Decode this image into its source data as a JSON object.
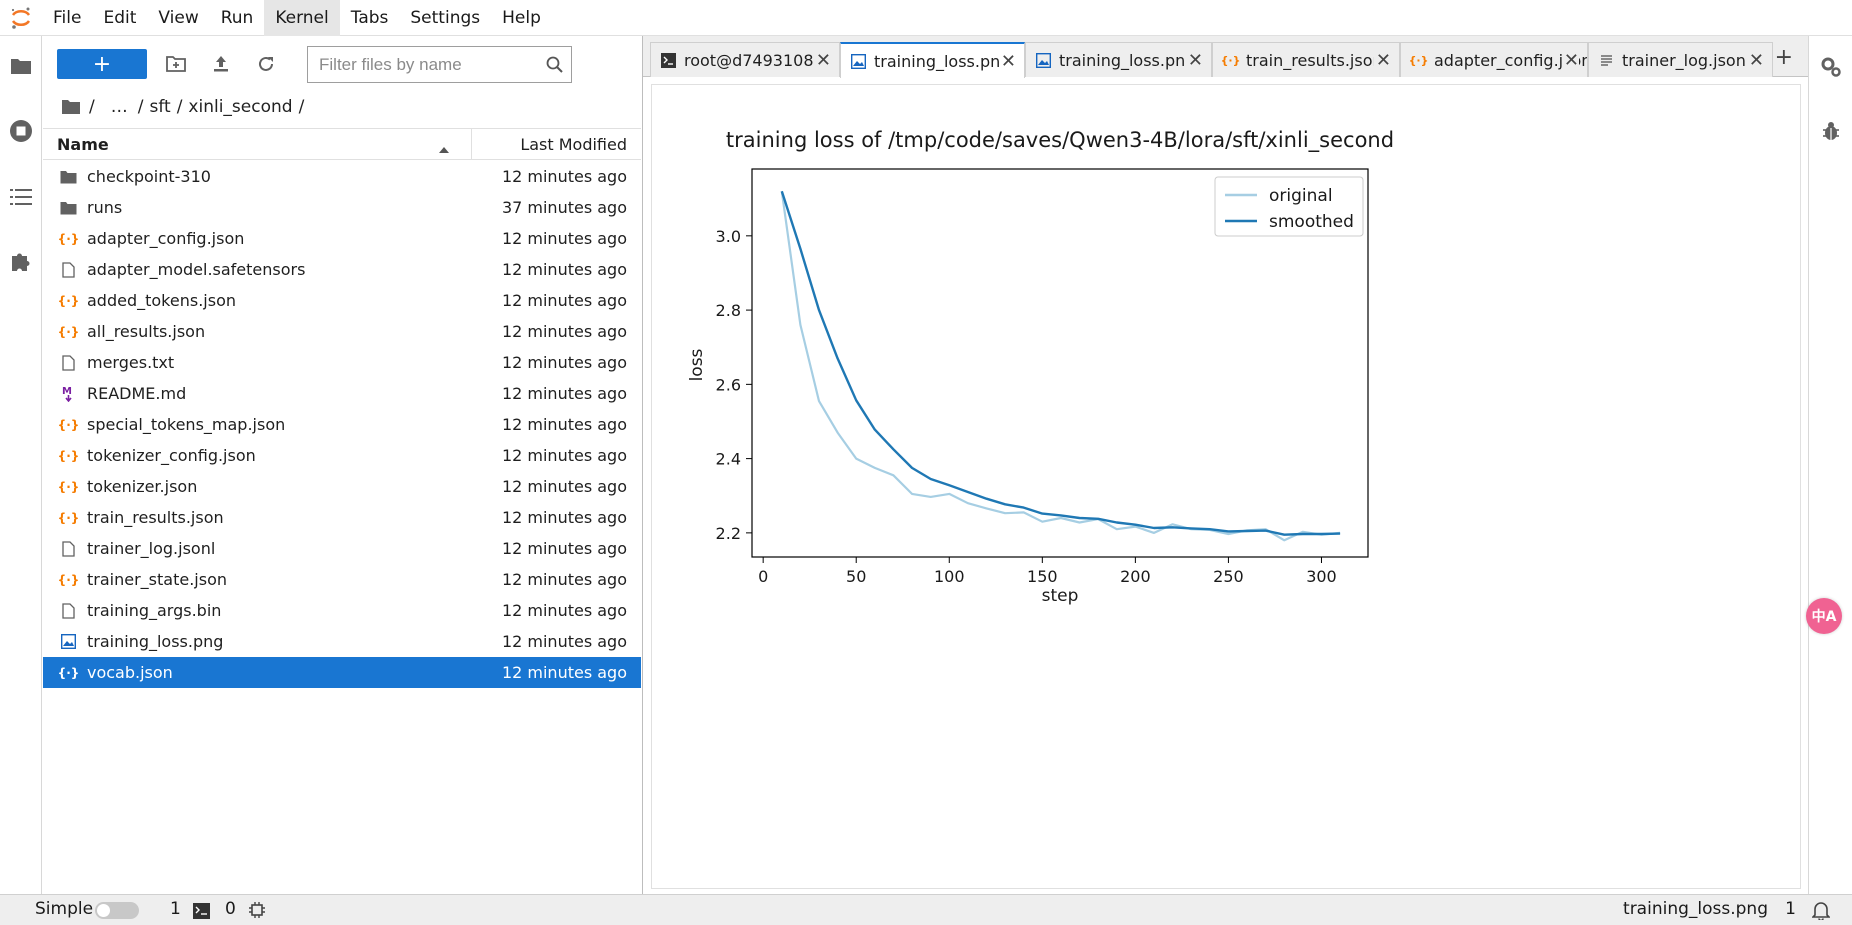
{
  "menu": {
    "items": [
      {
        "label": "File"
      },
      {
        "label": "Edit"
      },
      {
        "label": "View"
      },
      {
        "label": "Run"
      },
      {
        "label": "Kernel"
      },
      {
        "label": "Tabs"
      },
      {
        "label": "Settings"
      },
      {
        "label": "Help"
      }
    ],
    "active": "Kernel"
  },
  "filebrowser": {
    "new_button_label": "+",
    "filter_placeholder": "Filter files by name",
    "breadcrumb": [
      "/",
      "…",
      "/",
      "sft",
      "/",
      "xinli_second",
      "/"
    ],
    "columns": {
      "name": "Name",
      "modified": "Last Modified"
    },
    "files": [
      {
        "name": "checkpoint-310",
        "type": "folder",
        "modified": "12 minutes ago"
      },
      {
        "name": "runs",
        "type": "folder",
        "modified": "37 minutes ago"
      },
      {
        "name": "adapter_config.json",
        "type": "json",
        "modified": "12 minutes ago"
      },
      {
        "name": "adapter_model.safetensors",
        "type": "file",
        "modified": "12 minutes ago"
      },
      {
        "name": "added_tokens.json",
        "type": "json",
        "modified": "12 minutes ago"
      },
      {
        "name": "all_results.json",
        "type": "json",
        "modified": "12 minutes ago"
      },
      {
        "name": "merges.txt",
        "type": "file",
        "modified": "12 minutes ago"
      },
      {
        "name": "README.md",
        "type": "markdown",
        "modified": "12 minutes ago"
      },
      {
        "name": "special_tokens_map.json",
        "type": "json",
        "modified": "12 minutes ago"
      },
      {
        "name": "tokenizer_config.json",
        "type": "json",
        "modified": "12 minutes ago"
      },
      {
        "name": "tokenizer.json",
        "type": "json",
        "modified": "12 minutes ago"
      },
      {
        "name": "train_results.json",
        "type": "json",
        "modified": "12 minutes ago"
      },
      {
        "name": "trainer_log.jsonl",
        "type": "file",
        "modified": "12 minutes ago"
      },
      {
        "name": "trainer_state.json",
        "type": "json",
        "modified": "12 minutes ago"
      },
      {
        "name": "training_args.bin",
        "type": "file",
        "modified": "12 minutes ago"
      },
      {
        "name": "training_loss.png",
        "type": "image",
        "modified": "12 minutes ago"
      },
      {
        "name": "vocab.json",
        "type": "json",
        "modified": "12 minutes ago",
        "selected": true
      }
    ]
  },
  "tabs": [
    {
      "label": "root@d7493108",
      "icon": "terminal-icon"
    },
    {
      "label": "training_loss.png",
      "icon": "image-icon",
      "current": true
    },
    {
      "label": "training_loss.png",
      "icon": "image-icon"
    },
    {
      "label": "train_results.json",
      "icon": "json-icon"
    },
    {
      "label": "adapter_config.json",
      "icon": "json-icon"
    },
    {
      "label": "trainer_log.jsonl",
      "icon": "text-file-icon"
    }
  ],
  "chart_data": {
    "type": "line",
    "title": "training loss of /tmp/code/saves/Qwen3-4B/lora/sft/xinli_second",
    "xlabel": "step",
    "ylabel": "loss",
    "xlim": [
      -6,
      325
    ],
    "ylim": [
      2.135,
      3.18
    ],
    "xticks": [
      0,
      50,
      100,
      150,
      200,
      250,
      300
    ],
    "yticks": [
      2.2,
      2.4,
      2.6,
      2.8,
      3.0
    ],
    "legend_position": "top-right",
    "x": [
      10,
      20,
      30,
      40,
      50,
      60,
      70,
      80,
      90,
      100,
      110,
      120,
      130,
      140,
      150,
      160,
      170,
      180,
      190,
      200,
      210,
      220,
      230,
      240,
      250,
      260,
      270,
      280,
      290,
      300,
      310
    ],
    "series": [
      {
        "name": "original",
        "color": "#a6cee3",
        "values": [
          3.12,
          2.76,
          2.555,
          2.47,
          2.4,
          2.375,
          2.355,
          2.305,
          2.297,
          2.305,
          2.28,
          2.266,
          2.253,
          2.255,
          2.23,
          2.24,
          2.228,
          2.237,
          2.21,
          2.217,
          2.2,
          2.223,
          2.21,
          2.208,
          2.197,
          2.207,
          2.21,
          2.18,
          2.203,
          2.195,
          2.2
        ]
      },
      {
        "name": "smoothed",
        "color": "#1f78b4",
        "values": [
          3.12,
          2.965,
          2.8,
          2.67,
          2.557,
          2.478,
          2.425,
          2.375,
          2.345,
          2.328,
          2.31,
          2.292,
          2.277,
          2.268,
          2.252,
          2.247,
          2.24,
          2.238,
          2.228,
          2.222,
          2.213,
          2.215,
          2.212,
          2.21,
          2.204,
          2.205,
          2.206,
          2.195,
          2.197,
          2.197,
          2.198
        ]
      }
    ]
  },
  "status": {
    "mode": "Simple",
    "terminals": "1",
    "kernels": "0",
    "filename": "training_loss.png",
    "count": "1"
  },
  "translate_bubble": "中A"
}
